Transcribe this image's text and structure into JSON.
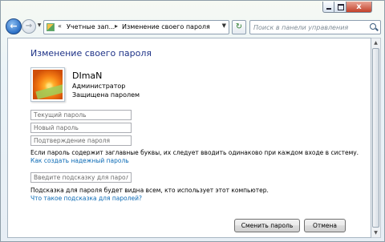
{
  "titlebar": {
    "minimize_label": "",
    "maximize_label": "",
    "close_label": "x"
  },
  "nav": {
    "back_glyph": "←",
    "forward_glyph": "→",
    "history_glyph": "▼"
  },
  "address": {
    "chevron_lead": "«",
    "segments": [
      "Учетные зап...",
      "Изменение своего пароля"
    ],
    "chevron": "▸",
    "dropdown_glyph": "▼",
    "refresh_glyph": "↻"
  },
  "search": {
    "placeholder": "Поиск в панели управления"
  },
  "page": {
    "title": "Изменение своего пароля"
  },
  "user": {
    "name": "DImaN",
    "role": "Администратор",
    "status": "Защищена паролем"
  },
  "form": {
    "current_placeholder": "Текущий пароль",
    "new_placeholder": "Новый пароль",
    "confirm_placeholder": "Подтверждение пароля",
    "caps_note": "Если пароль содержит заглавные буквы, их следует вводить одинаково при каждом входе в систему.",
    "strong_link": "Как создать надежный пароль",
    "hint_placeholder": "Введите подсказку для пароля",
    "hint_note": "Подсказка для пароля будет видна всем, кто использует этот компьютер.",
    "hint_link": "Что такое подсказка для паролей?"
  },
  "buttons": {
    "change": "Сменить пароль",
    "cancel": "Отмена"
  },
  "scroll": {
    "up_glyph": "▲",
    "down_glyph": "▼"
  }
}
